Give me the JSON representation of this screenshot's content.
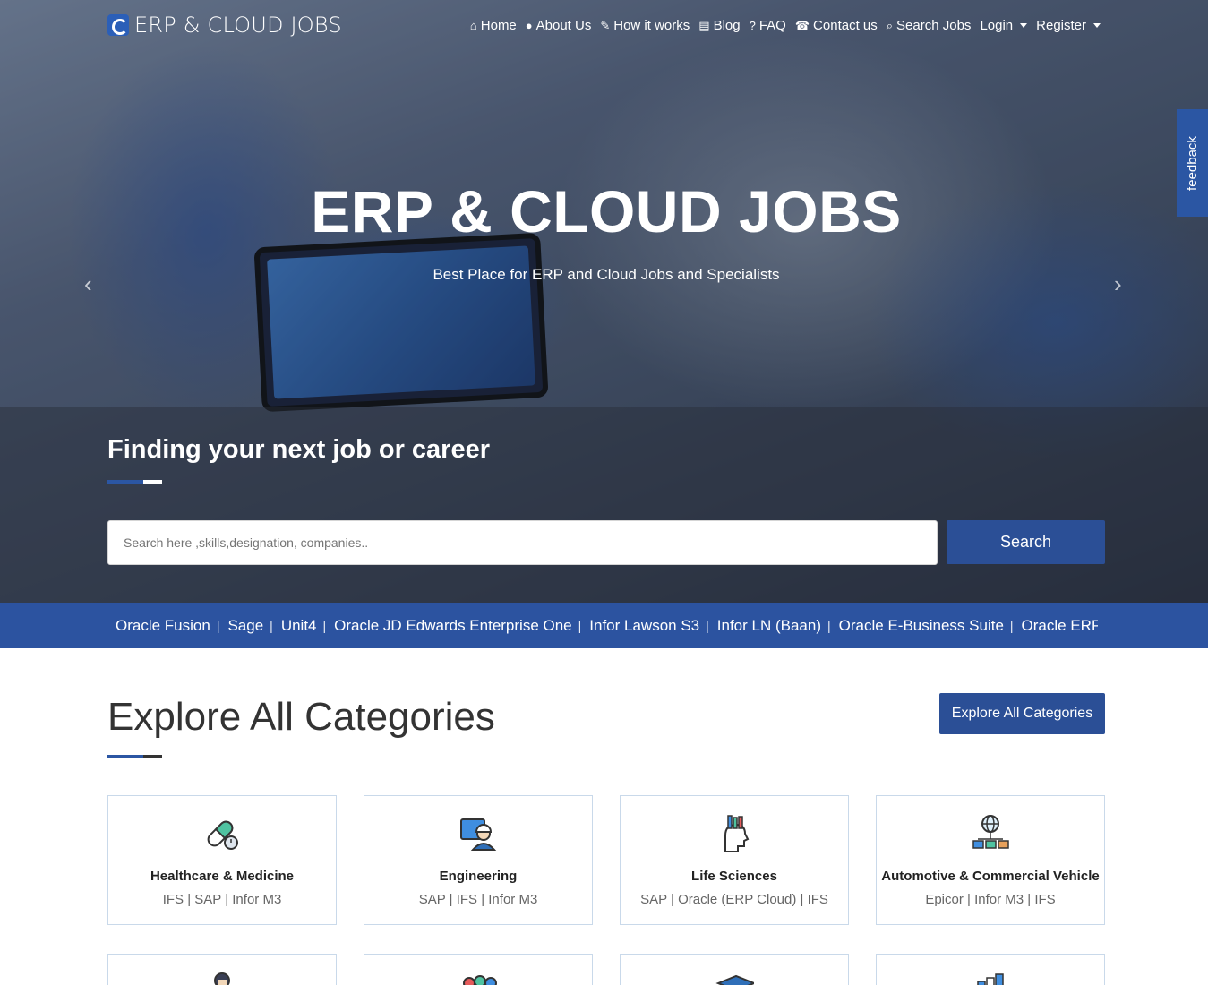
{
  "brand": {
    "logo_text": "ERP & CLOUD JOBS"
  },
  "nav": [
    {
      "label": "Home",
      "icon": "home-icon",
      "glyph": "⌂"
    },
    {
      "label": "About Us",
      "icon": "user-icon",
      "glyph": "👤"
    },
    {
      "label": "How it works",
      "icon": "wrench-icon",
      "glyph": "🔧"
    },
    {
      "label": "Blog",
      "icon": "book-icon",
      "glyph": "📖"
    },
    {
      "label": "FAQ",
      "icon": "question-icon",
      "glyph": "?"
    },
    {
      "label": "Contact us",
      "icon": "phone-icon",
      "glyph": "☎"
    },
    {
      "label": "Search Jobs",
      "icon": "search-icon",
      "glyph": "⌕"
    }
  ],
  "nav_dropdowns": {
    "login": "Login",
    "register": "Register"
  },
  "feedback_label": "feedback",
  "hero": {
    "title": "ERP & CLOUD JOBS",
    "subtitle": "Best Place for ERP and Cloud Jobs and Specialists",
    "find_title": "Finding your next job or career",
    "search_placeholder": "Search here ,skills,designation, companies..",
    "search_button": "Search"
  },
  "ticker": [
    "Oracle Fusion",
    "Sage",
    "Unit4",
    "Oracle JD Edwards Enterprise One",
    "Infor Lawson S3",
    "Infor LN (Baan)",
    "Oracle E-Business Suite",
    "Oracle ERP Cloud"
  ],
  "categories": {
    "title": "Explore All Categories",
    "button": "Explore All Categories",
    "cards": [
      {
        "title": "Healthcare & Medicine",
        "sub": "IFS | SAP | Infor M3",
        "icon": "pill-icon"
      },
      {
        "title": "Engineering",
        "sub": "SAP | IFS | Infor M3",
        "icon": "engineer-icon"
      },
      {
        "title": "Life Sciences",
        "sub": "SAP | Oracle (ERP Cloud) | IFS",
        "icon": "brain-icon"
      },
      {
        "title": "Automotive & Commercial Vehicle",
        "sub": "Epicor | Infor M3 | IFS",
        "icon": "network-icon"
      }
    ],
    "row2_icons": [
      "person-icon",
      "gears-icon",
      "graduation-cap-icon",
      "tools-icon"
    ]
  },
  "colors": {
    "accent": "#2b56a3",
    "button": "#2b4f96",
    "ticker": "#2c53a0"
  }
}
